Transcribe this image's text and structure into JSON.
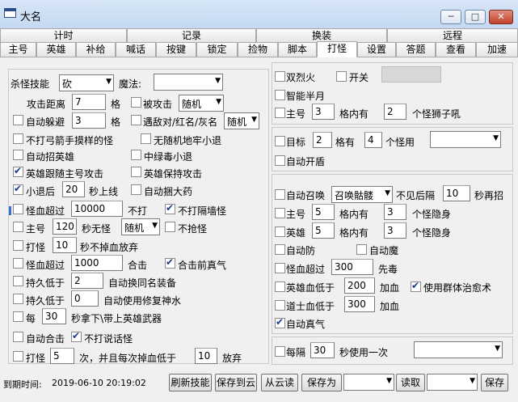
{
  "window": {
    "title": "大名",
    "minimize": "─",
    "maximize": "□",
    "close": "✕"
  },
  "tabs_top": [
    "计时",
    "记录",
    "换装",
    "远程"
  ],
  "tabs_bottom": [
    "主号",
    "英雄",
    "补给",
    "喊话",
    "按键",
    "锁定",
    "捡物",
    "脚本",
    "打怪",
    "设置",
    "答题",
    "查看",
    "加速"
  ],
  "active_tab": "打怪",
  "left": {
    "skill_label": "杀怪技能",
    "skill_value": "砍",
    "magic_label": "魔法:",
    "magic_value": "",
    "attack_dist_label": "攻击距离",
    "attack_dist_value": "7",
    "attack_dist_unit": "格",
    "attacked_label": "被攻击",
    "attacked_mode": "随机",
    "auto_dodge_label": "自动躲避",
    "auto_dodge_value": "3",
    "auto_dodge_unit": "格",
    "meet_enemy_label": "遇敌对/红名/灰名",
    "meet_enemy_mode": "随机",
    "no_archer_label": "不打弓箭手摸样的怪",
    "no_lure_label": "无随机地牢小退",
    "auto_summon_label": "自动招英雄",
    "mid_poison_label": "中绿毒小退",
    "follow_label": "英雄跟随主号攻击",
    "hero_keep_label": "英雄保持攻击",
    "retreat_label": "小退后",
    "retreat_value": "20",
    "retreat_unit": "秒上线",
    "auto_catch_label": "自动捆大药",
    "hp_over_label": "怪血超过",
    "hp_over_value": "10000",
    "hp_over_unit": "不打",
    "no_wall_label": "不打隔墙怪",
    "main_label": "主号",
    "main_value": "120",
    "main_unit": "秒无怪",
    "main_mode": "随机",
    "no_grab_label": "不抢怪",
    "hit_label": "打怪",
    "hit_value": "10",
    "hit_unit": "秒不掉血放弃",
    "hp_over2_label": "怪血超过",
    "hp_over2_value": "1000",
    "hp_over2_unit": "合击",
    "combo_label": "合击前真气",
    "dur_low_label": "持久低于",
    "dur_low_value": "2",
    "dur_low_unit": "自动换同名装备",
    "dur_low2_label": "持久低于",
    "dur_low2_value": "0",
    "dur_low2_unit": "自动使用修复神水",
    "every_label": "每",
    "every_value": "30",
    "every_unit": "秒拿下\\带上英雄武器",
    "auto_combo_label": "自动合击",
    "no_talk_label": "不打说话怪",
    "hit2_label": "打怪",
    "hit2_value": "5",
    "hit2_unit1": "次，并且每次掉血低于",
    "hit2_value2": "10",
    "hit2_unit2": "放弃"
  },
  "right": {
    "fire_label": "双烈火",
    "switch_label": "开关",
    "half_moon_label": "智能半月",
    "main_label": "主号",
    "main_value": "3",
    "main_unit": "格内有",
    "main_value2": "2",
    "main_unit2": "个怪狮子吼",
    "target_label": "目标",
    "target_value": "2",
    "target_unit": "格有",
    "target_value2": "4",
    "target_unit2": "个怪用",
    "target_select": "",
    "auto_shield_label": "自动开盾",
    "auto_summon_label": "自动召唤",
    "summon_value": "召唤骷髅",
    "summon_unit": "不见后隔",
    "summon_time": "10",
    "summon_unit2": "秒再招",
    "main2_label": "主号",
    "main2_value": "5",
    "main2_unit": "格内有",
    "main2_value2": "3",
    "main2_unit2": "个怪隐身",
    "hero_label": "英雄",
    "hero_value": "5",
    "hero_unit": "格内有",
    "hero_value2": "3",
    "hero_unit2": "个怪隐身",
    "auto_def_label": "自动防",
    "auto_magic_label": "自动魔",
    "hp_over_label": "怪血超过",
    "hp_over_value": "300",
    "hp_over_unit": "先毒",
    "hero_hp_label": "英雄血低于",
    "hero_hp_value": "200",
    "hero_hp_unit": "加血",
    "group_heal_label": "使用群体治愈术",
    "taoist_hp_label": "道士血低于",
    "taoist_hp_value": "300",
    "taoist_hp_unit": "加血",
    "auto_qi_label": "自动真气",
    "every_label": "每隔",
    "every_value": "30",
    "every_unit": "秒使用一次",
    "every_select": ""
  },
  "status": {
    "expire_label": "到期时间:",
    "expire_value": "2019-06-10 20:19:02",
    "refresh_btn": "刷新技能",
    "save_cloud_btn": "保存到云",
    "from_cloud_btn": "从云读",
    "save_as_btn": "保存为",
    "save_as_select": "",
    "read_btn": "读取",
    "read_select": "",
    "save_btn": "保存"
  }
}
